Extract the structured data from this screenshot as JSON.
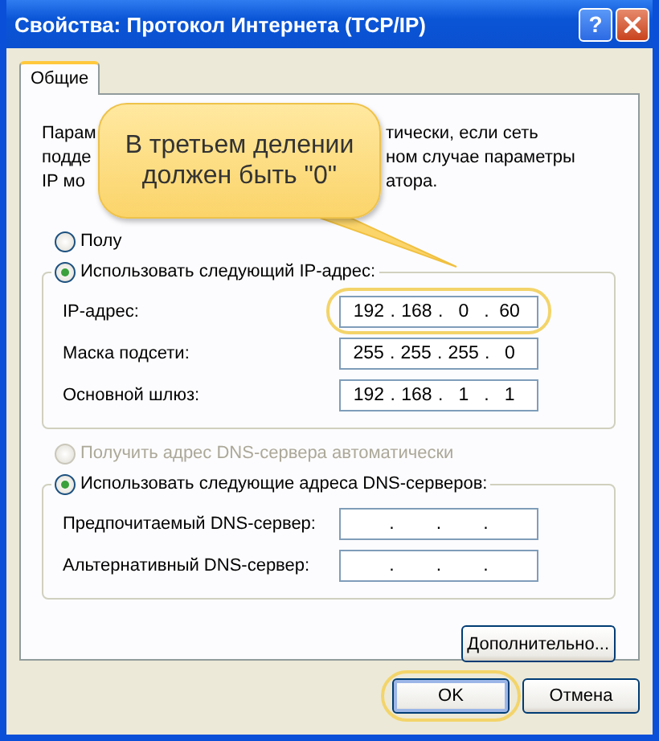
{
  "window": {
    "title": "Свойства: Протокол Интернета (TCP/IP)",
    "help_button": "?"
  },
  "tabs": [
    {
      "label": "Общие",
      "selected": true
    }
  ],
  "intro": {
    "lines": [
      {
        "left": "Парам",
        "right": "тически, если сеть"
      },
      {
        "left": "подде",
        "right": "ном случае параметры"
      },
      {
        "left": "IP мо",
        "right": "атора."
      }
    ]
  },
  "ip_auto": {
    "label": "Полу",
    "selected": false,
    "disabled": false
  },
  "ip_manual": {
    "label": "Использовать следующий IP-адрес:",
    "selected": true,
    "fields": [
      {
        "label": "IP-адрес:",
        "octets": [
          "192",
          "168",
          "0",
          "60"
        ],
        "dots": [
          ".",
          ".",
          "."
        ],
        "highlighted": true
      },
      {
        "label": "Маска подсети:",
        "octets": [
          "255",
          "255",
          "255",
          "0"
        ],
        "dots": [
          ".",
          ".",
          "."
        ],
        "highlighted": false
      },
      {
        "label": "Основной шлюз:",
        "octets": [
          "192",
          "168",
          "1",
          "1"
        ],
        "dots": [
          ".",
          ".",
          "."
        ],
        "highlighted": false
      }
    ]
  },
  "dns_auto": {
    "label": "Получить адрес DNS-сервера автоматически",
    "selected": false,
    "disabled": true
  },
  "dns_manual": {
    "label": "Использовать следующие адреса DNS-серверов:",
    "selected": true,
    "fields": [
      {
        "label": "Предпочитаемый DNS-сервер:",
        "dots": [
          ".",
          ".",
          "."
        ],
        "highlighted": false
      },
      {
        "label": "Альтернативный DNS-сервер:",
        "dots": [
          ".",
          ".",
          "."
        ],
        "highlighted": false
      }
    ]
  },
  "advanced_button": {
    "label": "Дополнительно..."
  },
  "buttons": [
    {
      "label": "OK",
      "highlighted": true,
      "default": true
    },
    {
      "label": "Отмена",
      "highlighted": false,
      "default": false
    }
  ],
  "callout": {
    "text": "В третьем делении должен быть \"0\""
  }
}
